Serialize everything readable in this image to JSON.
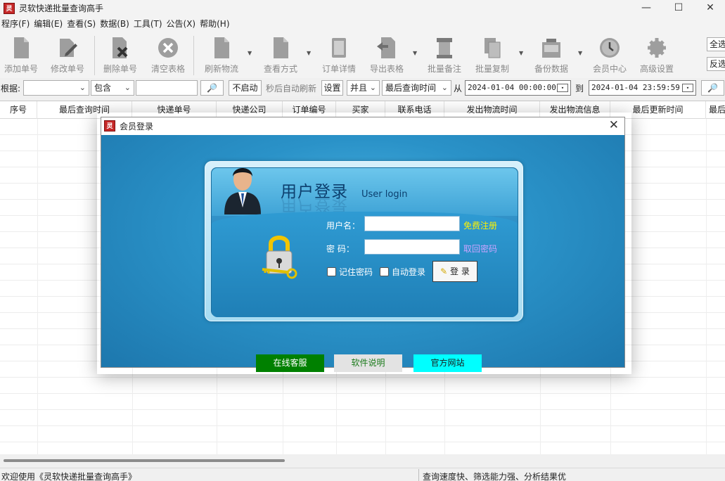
{
  "app": {
    "title": "灵软快递批量查询高手",
    "icon_text": "灵软"
  },
  "window_controls": [
    "—",
    "☐",
    "✕"
  ],
  "menu": [
    "程序(F)",
    "编辑(E)",
    "查看(S)",
    "数据(B)",
    "工具(T)",
    "公告(X)",
    "帮助(H)"
  ],
  "toolbar": {
    "buttons": [
      {
        "label": "添加单号",
        "icon": "document-icon"
      },
      {
        "label": "修改单号",
        "icon": "edit-icon"
      },
      {
        "label": "删除单号",
        "icon": "delete-icon"
      },
      {
        "label": "清空表格",
        "icon": "clear-icon"
      },
      {
        "label": "刷新物流",
        "icon": "refresh-icon"
      },
      {
        "label": "查看方式",
        "icon": "view-icon"
      },
      {
        "label": "订单详情",
        "icon": "detail-icon"
      },
      {
        "label": "导出表格",
        "icon": "export-icon"
      },
      {
        "label": "批量备注",
        "icon": "note-icon"
      },
      {
        "label": "批量复制",
        "icon": "copy-icon"
      },
      {
        "label": "备份数据",
        "icon": "backup-icon"
      },
      {
        "label": "会员中心",
        "icon": "clock-icon"
      },
      {
        "label": "高级设置",
        "icon": "gear-icon"
      }
    ],
    "side_buttons": [
      "全选",
      "反选"
    ]
  },
  "filter": {
    "label": "根据:",
    "field_value": "",
    "match_value": "包含",
    "keyword": "",
    "search_icon": "🔎",
    "auto_button": "不启动",
    "auto_text": "秒后自动刷新",
    "settings_button": "设置",
    "logic_value": "并且",
    "time_field_value": "最后查询时间",
    "from_label": "从",
    "date_from": "2024-01-04 00:00:00",
    "to_label": "到",
    "date_to": "2024-01-04 23:59:59"
  },
  "grid": {
    "columns": [
      "序号",
      "最后查询时间",
      "快递单号",
      "快递公司",
      "订单编号",
      "买家",
      "联系电话",
      "发出物流时间",
      "发出物流信息",
      "最后更新时间",
      "最后"
    ]
  },
  "status": {
    "left": "欢迎使用《灵软快递批量查询高手》",
    "right": "查询速度快、筛选能力强、分析结果优"
  },
  "dialog": {
    "title": "会员登录",
    "close": "✕",
    "heading": "用户登录",
    "heading_en": "User login",
    "username_label": "用户名：",
    "password_label": "密  码：",
    "username_value": "",
    "password_value": "",
    "register_link": "免费注册",
    "recover_link": "取回密码",
    "remember_label": "记住密码",
    "autologin_label": "自动登录",
    "login_button": "登 录",
    "footer": [
      {
        "label": "在线客服",
        "bg": "#008000",
        "fg": "#ffffff"
      },
      {
        "label": "软件说明",
        "bg": "#e3e3e3",
        "fg": "#1a7a1a"
      },
      {
        "label": "官方网站",
        "bg": "#00ffff",
        "fg": "#1a1a1a"
      }
    ]
  }
}
